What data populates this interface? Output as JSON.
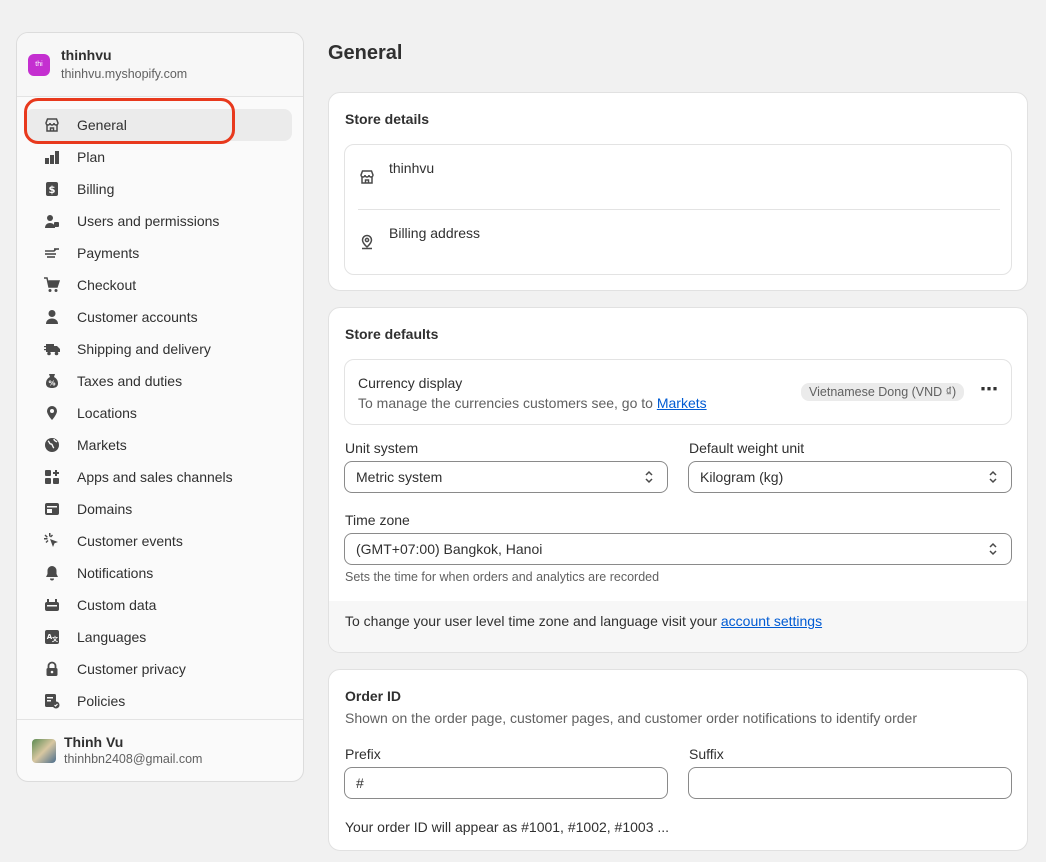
{
  "store": {
    "avatar_text": "thi",
    "name": "thinhvu",
    "domain": "thinhvu.myshopify.com"
  },
  "nav": [
    {
      "label": "General",
      "icon": "store-icon"
    },
    {
      "label": "Plan",
      "icon": "plan-icon"
    },
    {
      "label": "Billing",
      "icon": "billing-icon"
    },
    {
      "label": "Users and permissions",
      "icon": "users-icon"
    },
    {
      "label": "Payments",
      "icon": "payments-icon"
    },
    {
      "label": "Checkout",
      "icon": "cart-icon"
    },
    {
      "label": "Customer accounts",
      "icon": "person-icon"
    },
    {
      "label": "Shipping and delivery",
      "icon": "truck-icon"
    },
    {
      "label": "Taxes and duties",
      "icon": "tax-icon"
    },
    {
      "label": "Locations",
      "icon": "location-icon"
    },
    {
      "label": "Markets",
      "icon": "globe-icon"
    },
    {
      "label": "Apps and sales channels",
      "icon": "apps-icon"
    },
    {
      "label": "Domains",
      "icon": "domains-icon"
    },
    {
      "label": "Customer events",
      "icon": "cursor-icon"
    },
    {
      "label": "Notifications",
      "icon": "bell-icon"
    },
    {
      "label": "Custom data",
      "icon": "custom-data-icon"
    },
    {
      "label": "Languages",
      "icon": "language-icon"
    },
    {
      "label": "Customer privacy",
      "icon": "lock-icon"
    },
    {
      "label": "Policies",
      "icon": "policies-icon"
    }
  ],
  "user": {
    "name": "Thinh Vu",
    "email": "thinhbn2408@gmail.com"
  },
  "page": {
    "title": "General"
  },
  "store_details": {
    "title": "Store details",
    "store_name": "thinhvu",
    "billing_label": "Billing address"
  },
  "store_defaults": {
    "title": "Store defaults",
    "currency_label": "Currency display",
    "currency_help_prefix": "To manage the currencies customers see, go to ",
    "currency_help_link": "Markets",
    "currency_value": "Vietnamese Dong (VND ₫)",
    "more_label": "⋯",
    "unit_label": "Unit system",
    "unit_value": "Metric system",
    "weight_label": "Default weight unit",
    "weight_value": "Kilogram (kg)",
    "tz_label": "Time zone",
    "tz_value": "(GMT+07:00) Bangkok, Hanoi",
    "tz_help": "Sets the time for when orders and analytics are recorded",
    "footer_prefix": "To change your user level time zone and language visit your ",
    "footer_link": "account settings"
  },
  "order_id": {
    "title": "Order ID",
    "subtitle": "Shown on the order page, customer pages, and customer order notifications to identify order",
    "prefix_label": "Prefix",
    "prefix_value": "#",
    "suffix_label": "Suffix",
    "suffix_value": "",
    "preview": "Your order ID will appear as #1001, #1002, #1003 ..."
  },
  "colors": {
    "highlight": "#e8391d",
    "link": "#005bd3",
    "store_avatar": "#c42fd0"
  }
}
